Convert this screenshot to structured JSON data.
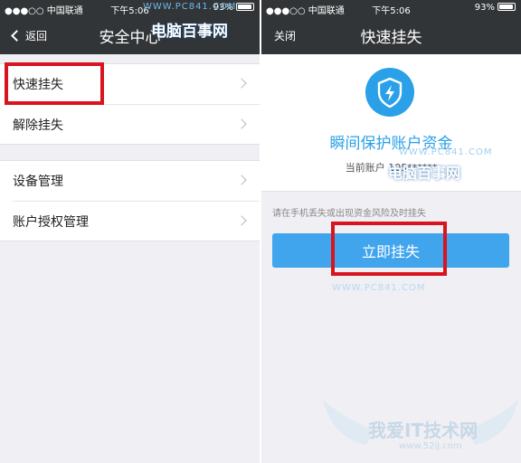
{
  "left_screen": {
    "status_bar": {
      "carrier": "●●●○○ 中国联通",
      "time": "下午5:06",
      "battery": "93%",
      "battery_level": 0.93
    },
    "nav": {
      "back_label": "返回",
      "title": "安全中心"
    },
    "menu_group_1": [
      {
        "label": "快速挂失"
      },
      {
        "label": "解除挂失"
      }
    ],
    "menu_group_2": [
      {
        "label": "设备管理"
      },
      {
        "label": "账户授权管理"
      }
    ]
  },
  "right_screen": {
    "status_bar": {
      "carrier": "●●●○○ 中国联通",
      "time": "下午5:06",
      "battery": "93%",
      "battery_level": 0.93
    },
    "nav": {
      "close_label": "关闭",
      "title": "快速挂失"
    },
    "panel": {
      "icon": "lightning-shield-icon",
      "title": "瞬间保护账户资金",
      "account_text": "当前账户 105******"
    },
    "hint": "请在手机丢失或出现资金风险及时挂失",
    "primary_button": "立即挂失"
  },
  "watermarks": {
    "site_name": "电脑百事网",
    "site_url": "WWW.PC841.COM",
    "corner_logo_text": "我爱IT技术网",
    "corner_logo_url": "www.52ij.com"
  },
  "colors": {
    "nav_bar": "#323537",
    "accent_blue": "#2aa0e8",
    "button_blue": "#41a5ee",
    "highlight_red": "#d8151e",
    "background": "#efeff4"
  }
}
